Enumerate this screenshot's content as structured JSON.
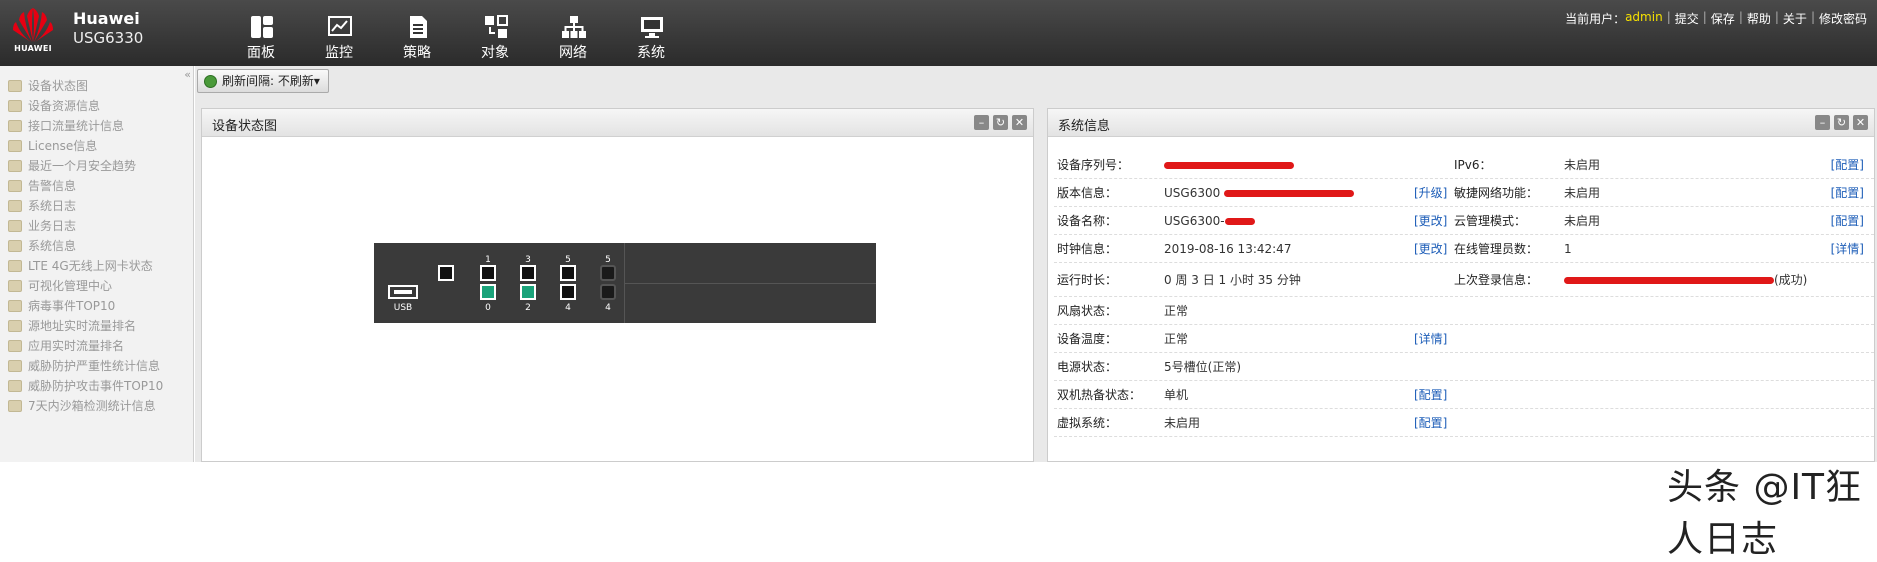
{
  "brand": {
    "logo_text": "HUAWEI",
    "name": "Huawei",
    "model": "USG6330"
  },
  "nav": [
    {
      "label": "面板",
      "icon": "dashboard-icon"
    },
    {
      "label": "监控",
      "icon": "monitor-icon"
    },
    {
      "label": "策略",
      "icon": "policy-icon"
    },
    {
      "label": "对象",
      "icon": "object-icon"
    },
    {
      "label": "网络",
      "icon": "network-icon"
    },
    {
      "label": "系统",
      "icon": "system-icon"
    }
  ],
  "toolbar": {
    "current_user_label": "当前用户：",
    "user": "admin",
    "links": [
      "提交",
      "保存",
      "帮助",
      "关于",
      "修改密码"
    ]
  },
  "sidebar": {
    "items": [
      "设备状态图",
      "设备资源信息",
      "接口流量统计信息",
      "License信息",
      "最近一个月安全趋势",
      "告警信息",
      "系统日志",
      "业务日志",
      "系统信息",
      "LTE 4G无线上网卡状态",
      "可视化管理中心",
      "病毒事件TOP10",
      "源地址实时流量排名",
      "应用实时流量排名",
      "威胁防护严重性统计信息",
      "威胁防护攻击事件TOP10",
      "7天内沙箱检测统计信息"
    ]
  },
  "refresh": {
    "label": "刷新间隔: 不刷新▾"
  },
  "panel_left": {
    "title": "设备状态图"
  },
  "device": {
    "usb_label": "USB",
    "top_labels": [
      "1",
      "3",
      "5",
      "5"
    ],
    "bottom_labels": [
      "0",
      "2",
      "4",
      "4"
    ]
  },
  "panel_right": {
    "title": "系统信息",
    "rows": [
      {
        "k": "设备序列号：",
        "v": "",
        "redact": "long",
        "act": "",
        "k2": "IPv6：",
        "v2": "未启用",
        "act2": "[配置]"
      },
      {
        "k": "版本信息：",
        "v": "USG6300 ",
        "redact": "long",
        "act": "[升级]",
        "k2": "敏捷网络功能：",
        "v2": "未启用",
        "act2": "[配置]"
      },
      {
        "k": "设备名称：",
        "v": "USG6300-",
        "redact": "short",
        "act": "[更改]",
        "k2": "云管理模式：",
        "v2": "未启用",
        "act2": "[配置]"
      },
      {
        "k": "时钟信息：",
        "v": "2019-08-16 13:42:47",
        "redact": "",
        "act": "[更改]",
        "k2": "在线管理员数：",
        "v2": "1",
        "act2": "[详情]"
      },
      {
        "k": "运行时长：",
        "v": "0 周 3 日 1 小时 35 分钟",
        "redact": "",
        "act": "",
        "k2": "上次登录信息：",
        "v2": "(成功)",
        "act2": ""
      },
      {
        "k": "风扇状态：",
        "v": "正常",
        "redact": "",
        "act": "",
        "k2": "",
        "v2": "",
        "act2": ""
      },
      {
        "k": "设备温度：",
        "v": "正常",
        "redact": "",
        "act": "[详情]",
        "k2": "",
        "v2": "",
        "act2": ""
      },
      {
        "k": "电源状态：",
        "v": "5号槽位(正常)",
        "redact": "",
        "act": "",
        "k2": "",
        "v2": "",
        "act2": ""
      },
      {
        "k": "双机热备状态：",
        "v": "单机",
        "redact": "",
        "act": "[配置]",
        "k2": "",
        "v2": "",
        "act2": ""
      },
      {
        "k": "虚拟系统：",
        "v": "未启用",
        "redact": "",
        "act": "[配置]",
        "k2": "",
        "v2": "",
        "act2": ""
      }
    ]
  },
  "watermark": "头条 @IT狂人日志"
}
